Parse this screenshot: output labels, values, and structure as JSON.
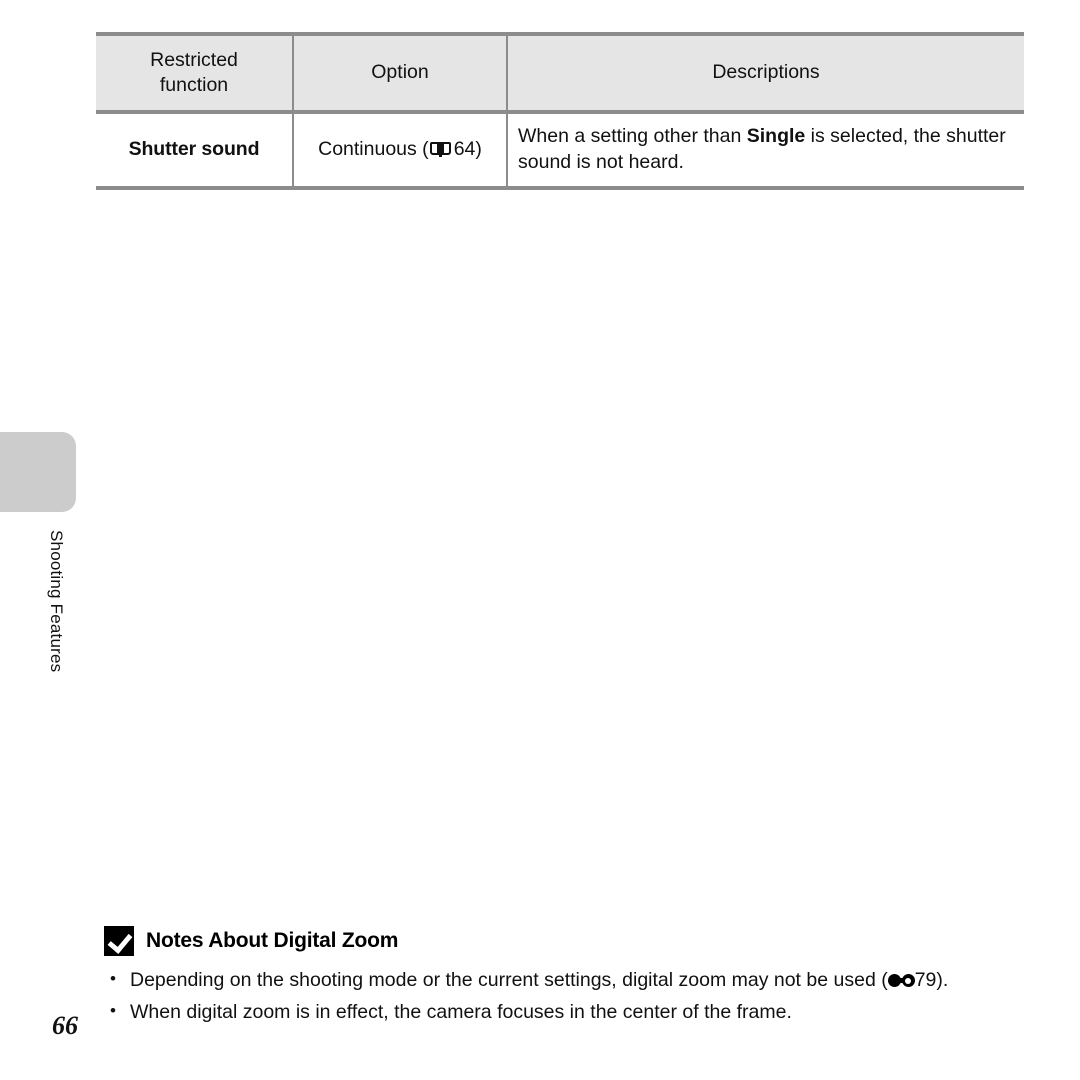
{
  "page": {
    "number": "66",
    "chapter_label": "Shooting Features"
  },
  "table": {
    "headers": [
      "Restricted function",
      "Option",
      "Descriptions"
    ],
    "header_lines": {
      "col1_line1": "Restricted",
      "col1_line2": "function",
      "col2": "Option",
      "col3": "Descriptions"
    },
    "rows": [
      {
        "function": "Shutter sound",
        "option_text": "Continuous (",
        "option_icon": "open-book-icon",
        "option_page_ref": "64",
        "option_suffix": ")",
        "description_pre": "When a setting other than ",
        "description_bold": "Single",
        "description_post": " is selected, the shutter sound is not heard."
      }
    ]
  },
  "notes": {
    "icon": "caution-check-icon",
    "title": "Notes About Digital Zoom",
    "items": [
      {
        "text_pre": "Depending on the shooting mode or the current settings, digital zoom may not be used (",
        "ref_icon": "reference-section-icon",
        "ref_page": "79",
        "text_post": ")."
      },
      {
        "text_pre": "When digital zoom is in effect, the camera focuses in the center of the frame.",
        "ref_icon": "",
        "ref_page": "",
        "text_post": ""
      }
    ]
  },
  "colors": {
    "table_header_bg": "#e5e5e5",
    "table_rule": "#8c8c8c",
    "side_tab": "#cccccc",
    "text": "#111111"
  }
}
